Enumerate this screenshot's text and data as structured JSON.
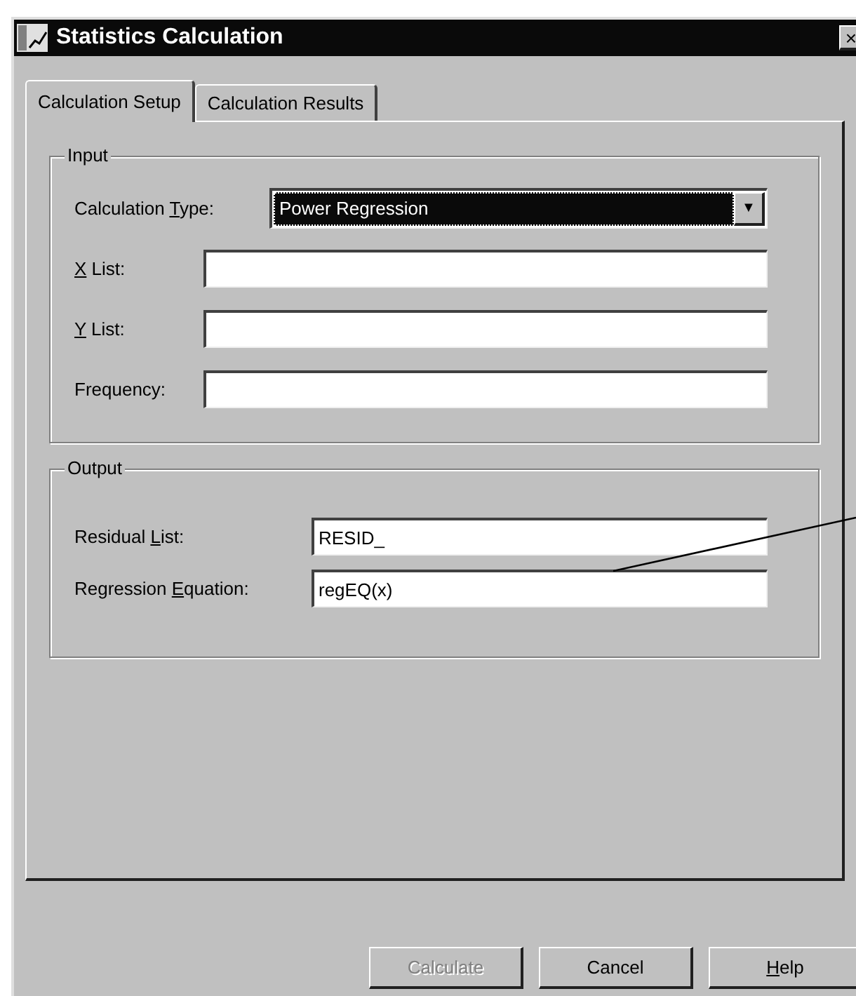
{
  "window": {
    "title": "Statistics Calculation",
    "close": "×"
  },
  "tabs": [
    {
      "label": "Calculation Setup",
      "selected": true
    },
    {
      "label": "Calculation Results",
      "selected": false
    }
  ],
  "input": {
    "title": "Input",
    "calculation_type": {
      "label_before": "Calculation ",
      "mnemonic": "T",
      "label_after": "ype:",
      "value": "Power Regression",
      "arrow": "▼"
    },
    "fields": [
      {
        "mnemonic": "X",
        "label_after": " List:"
      },
      {
        "mnemonic": "Y",
        "label_after": " List:"
      },
      {
        "label_before": "Frequency:"
      }
    ]
  },
  "output": {
    "title": "Output",
    "fields": [
      {
        "label_before": "Residual ",
        "mnemonic": "L",
        "label_after": "ist:",
        "value": "RESID_"
      },
      {
        "label_before": "Regression ",
        "mnemonic": "E",
        "label_after": "quation:",
        "value": "regEQ(x)"
      }
    ]
  },
  "buttons": [
    {
      "label_before": "Calculate",
      "disabled": true
    },
    {
      "label_before": "Cancel",
      "disabled": false
    },
    {
      "mnemonic": "H",
      "label_after": "elp",
      "disabled": false
    }
  ]
}
